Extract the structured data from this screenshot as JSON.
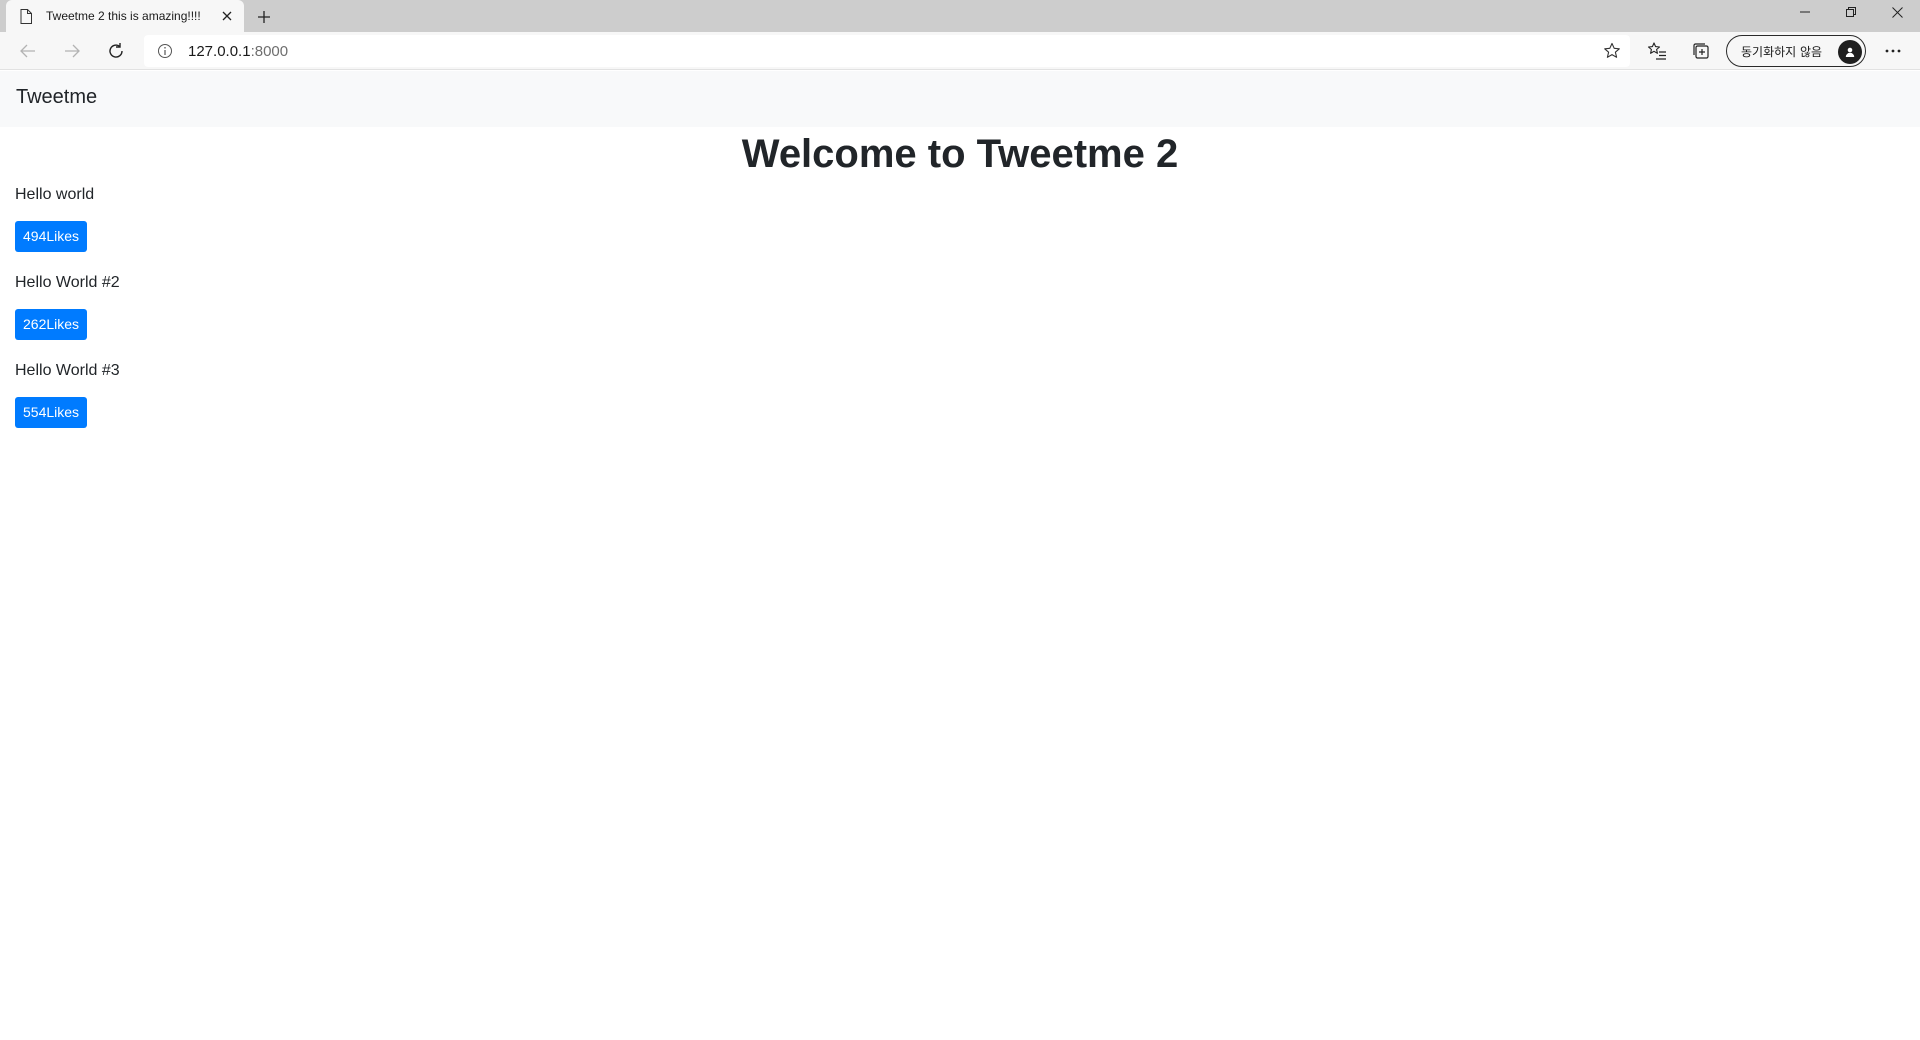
{
  "browser": {
    "tab_title": "Tweetme 2 this is amazing!!!!",
    "url_host": "127.0.0.1",
    "url_port": ":8000",
    "sync_label": "동기화하지 않음",
    "icons": {
      "page": "page-icon",
      "close": "close-icon",
      "new_tab": "plus-icon",
      "back": "arrow-left-icon",
      "forward": "arrow-right-icon",
      "refresh": "refresh-icon",
      "info": "info-icon",
      "favorite": "star-icon",
      "favorites": "favorites-icon",
      "collections": "collections-icon",
      "more": "more-icon"
    }
  },
  "navbar": {
    "brand": "Tweetme"
  },
  "page": {
    "title": "Welcome to Tweetme 2"
  },
  "tweets": [
    {
      "content": "Hello world",
      "likes_label": "494Likes"
    },
    {
      "content": "Hello World #2",
      "likes_label": "262Likes"
    },
    {
      "content": "Hello World #3",
      "likes_label": "554Likes"
    }
  ],
  "colors": {
    "primary": "#007bff",
    "navbar_bg": "#f8f9fa",
    "text": "#212529"
  }
}
